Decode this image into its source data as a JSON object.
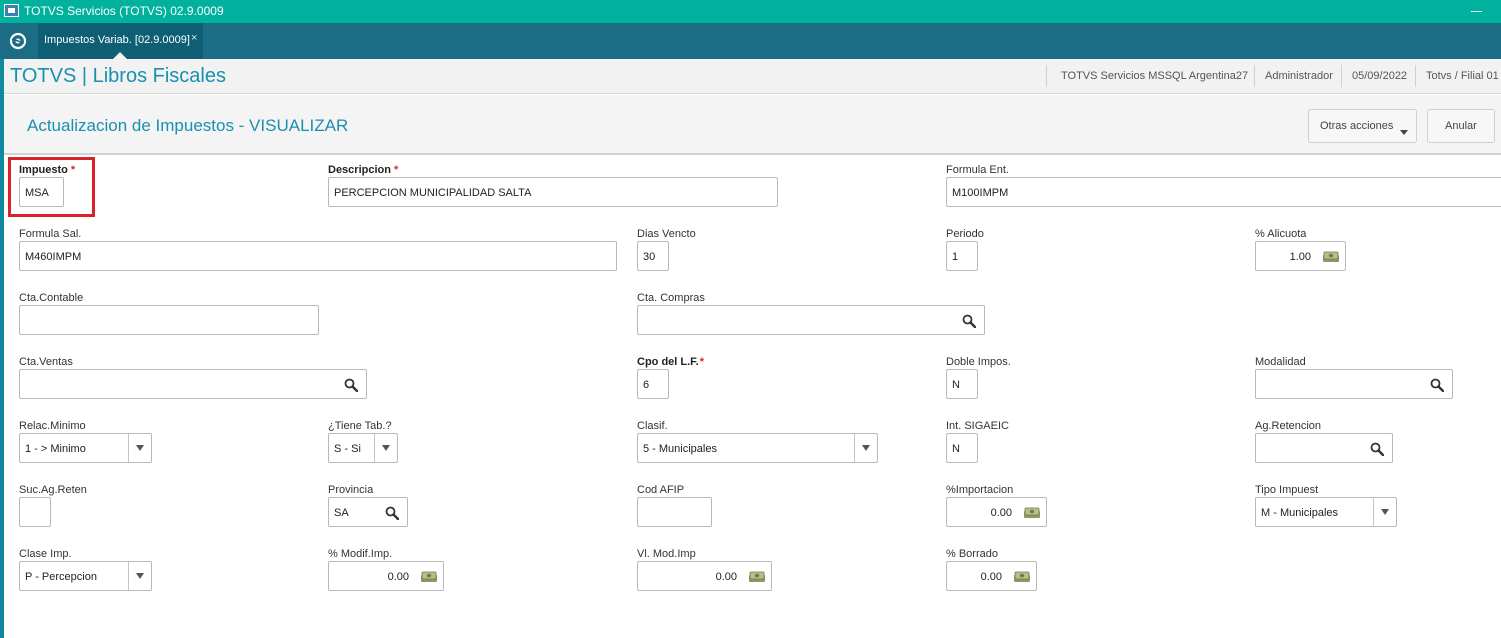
{
  "window": {
    "title": "TOTVS Servicios (TOTVS) 02.9.0009"
  },
  "tab": {
    "label": "Impuestos Variab. [02.9.0009]",
    "close": "×"
  },
  "header": {
    "app_title": "TOTVS | Libros Fiscales",
    "server": "TOTVS Servicios MSSQL Argentina27",
    "user": "Administrador",
    "date": "05/09/2022",
    "branch": "Totvs / Filial 01"
  },
  "page": {
    "title": "Actualizacion de Impuestos - VISUALIZAR",
    "more_actions": "Otras acciones",
    "cancel": "Anular"
  },
  "required_mark": "*",
  "colors": {
    "accent": "#1b8fb0",
    "titlebar": "#00b29e",
    "tabbar": "#1a6d85",
    "required": "#d9262c",
    "highlight": "#d8232a"
  },
  "fields": {
    "impuesto": {
      "label": "Impuesto",
      "value": "MSA"
    },
    "descripcion": {
      "label": "Descripcion",
      "value": "PERCEPCION MUNICIPALIDAD SALTA"
    },
    "formula_ent": {
      "label": "Formula Ent.",
      "value": "M100IMPM"
    },
    "formula_sal": {
      "label": "Formula Sal.",
      "value": "M460IMPM"
    },
    "dias_vencto": {
      "label": "Dias Vencto",
      "value": "30"
    },
    "periodo": {
      "label": "Periodo",
      "value": "1"
    },
    "alicuota": {
      "label": "% Alicuota",
      "value": "1.00"
    },
    "cta_contable": {
      "label": "Cta.Contable",
      "value": ""
    },
    "cta_compras": {
      "label": "Cta. Compras",
      "value": ""
    },
    "cta_ventas": {
      "label": "Cta.Ventas",
      "value": ""
    },
    "cpo_lf": {
      "label": "Cpo del L.F.",
      "value": "6"
    },
    "doble_impos": {
      "label": "Doble Impos.",
      "value": "N"
    },
    "modalidad": {
      "label": "Modalidad",
      "value": ""
    },
    "relac_minimo": {
      "label": "Relac.Minimo",
      "value": "1 -  > Minimo"
    },
    "tiene_tab": {
      "label": "¿Tiene Tab.?",
      "value": "S -  Si"
    },
    "clasif": {
      "label": "Clasif.",
      "value": "5 - Municipales"
    },
    "int_sigaeic": {
      "label": "Int. SIGAEIC",
      "value": "N"
    },
    "ag_retencion": {
      "label": "Ag.Retencion",
      "value": ""
    },
    "suc_ag_reten": {
      "label": "Suc.Ag.Reten",
      "value": ""
    },
    "provincia": {
      "label": "Provincia",
      "value": "SA"
    },
    "cod_afip": {
      "label": "Cod AFIP",
      "value": ""
    },
    "importacion": {
      "label": "%Importacion",
      "value": "0.00"
    },
    "tipo_impuest": {
      "label": "Tipo Impuest",
      "value": "M - Municipales"
    },
    "clase_imp": {
      "label": "Clase Imp.",
      "value": "P - Percepcion"
    },
    "modif_imp": {
      "label": "% Modif.Imp.",
      "value": "0.00"
    },
    "vl_mod_imp": {
      "label": "Vl. Mod.Imp",
      "value": "0.00"
    },
    "borrado": {
      "label": "% Borrado",
      "value": "0.00"
    }
  }
}
